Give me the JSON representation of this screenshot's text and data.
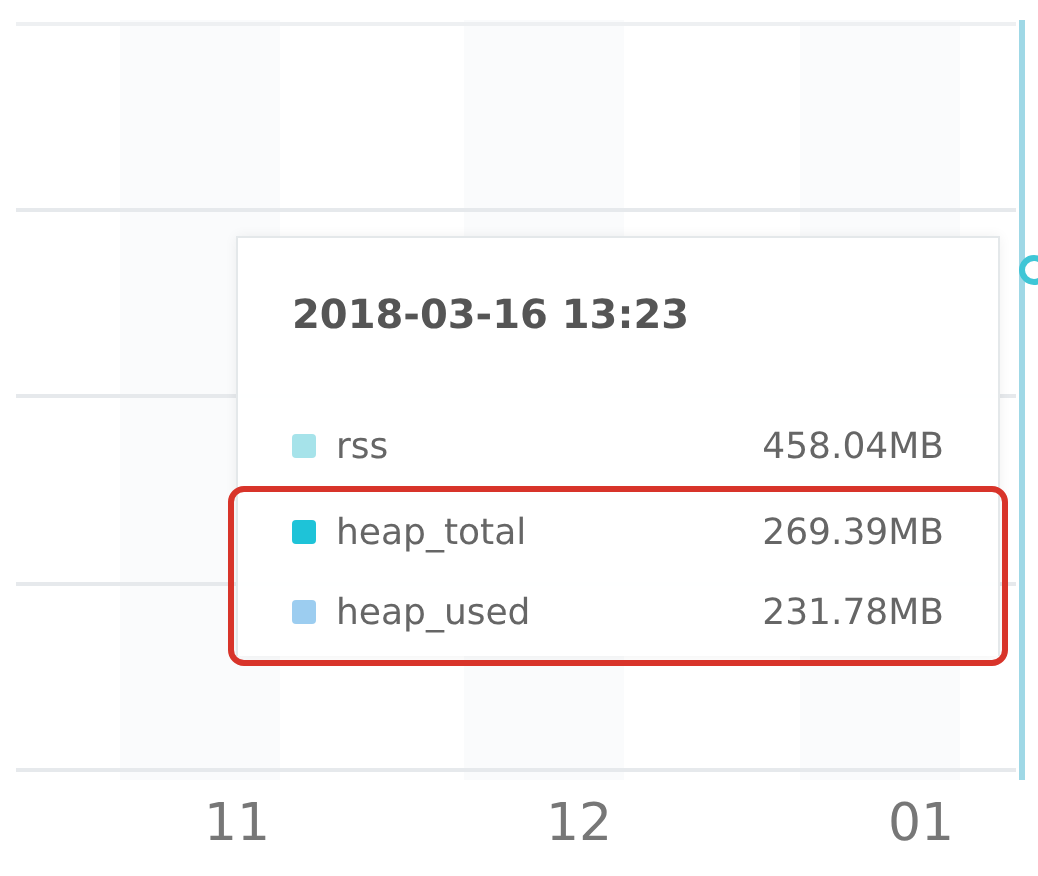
{
  "x_axis": {
    "labels": [
      "11",
      "12",
      "01"
    ]
  },
  "tooltip": {
    "title": "2018-03-16 13:23",
    "rows": [
      {
        "name": "rss",
        "value": "458.04MB",
        "color": "#a6e3ea",
        "highlighted": false
      },
      {
        "name": "heap_total",
        "value": "269.39MB",
        "color": "#1ec3d8",
        "highlighted": true
      },
      {
        "name": "heap_used",
        "value": "231.78MB",
        "color": "#9ccdf0",
        "highlighted": true
      }
    ]
  }
}
